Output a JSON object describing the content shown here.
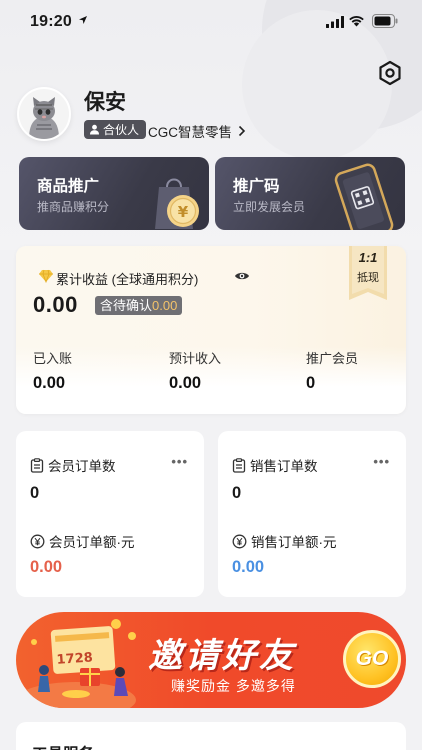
{
  "status_bar": {
    "time": "19:20"
  },
  "profile": {
    "name": "保安",
    "role": "合伙人",
    "shop": "CGC智慧零售"
  },
  "cards": {
    "promo": {
      "title": "商品推广",
      "subtitle": "推商品赚积分"
    },
    "qr": {
      "title": "推广码",
      "subtitle": "立即发展会员"
    }
  },
  "earnings": {
    "title": "累计收益 (全球通用积分)",
    "total": "0.00",
    "pending_label": "含待确认",
    "pending_value": "0.00",
    "ribbon_ratio": "1:1",
    "ribbon_text": "抵现",
    "stats": [
      {
        "label": "已入账",
        "value": "0.00"
      },
      {
        "label": "预计收入",
        "value": "0.00"
      },
      {
        "label": "推广会员",
        "value": "0"
      }
    ]
  },
  "orders": {
    "member": {
      "count_label": "会员订单数",
      "count": "0",
      "amount_label": "会员订单额·元",
      "amount": "0.00",
      "amount_color": "#e5614b"
    },
    "sales": {
      "count_label": "销售订单数",
      "count": "0",
      "amount_label": "销售订单额·元",
      "amount": "0.00",
      "amount_color": "#4a90e2"
    }
  },
  "banner": {
    "title": "邀请好友",
    "slogan": "赚奖励金 多邀多得",
    "go": "GO",
    "deco_amount": "1728"
  },
  "tools": {
    "title": "工具服务"
  },
  "colors": {
    "accent_gold": "#f3c36a",
    "dark_card": "#3a3a48",
    "banner_red": "#f04a2a"
  }
}
